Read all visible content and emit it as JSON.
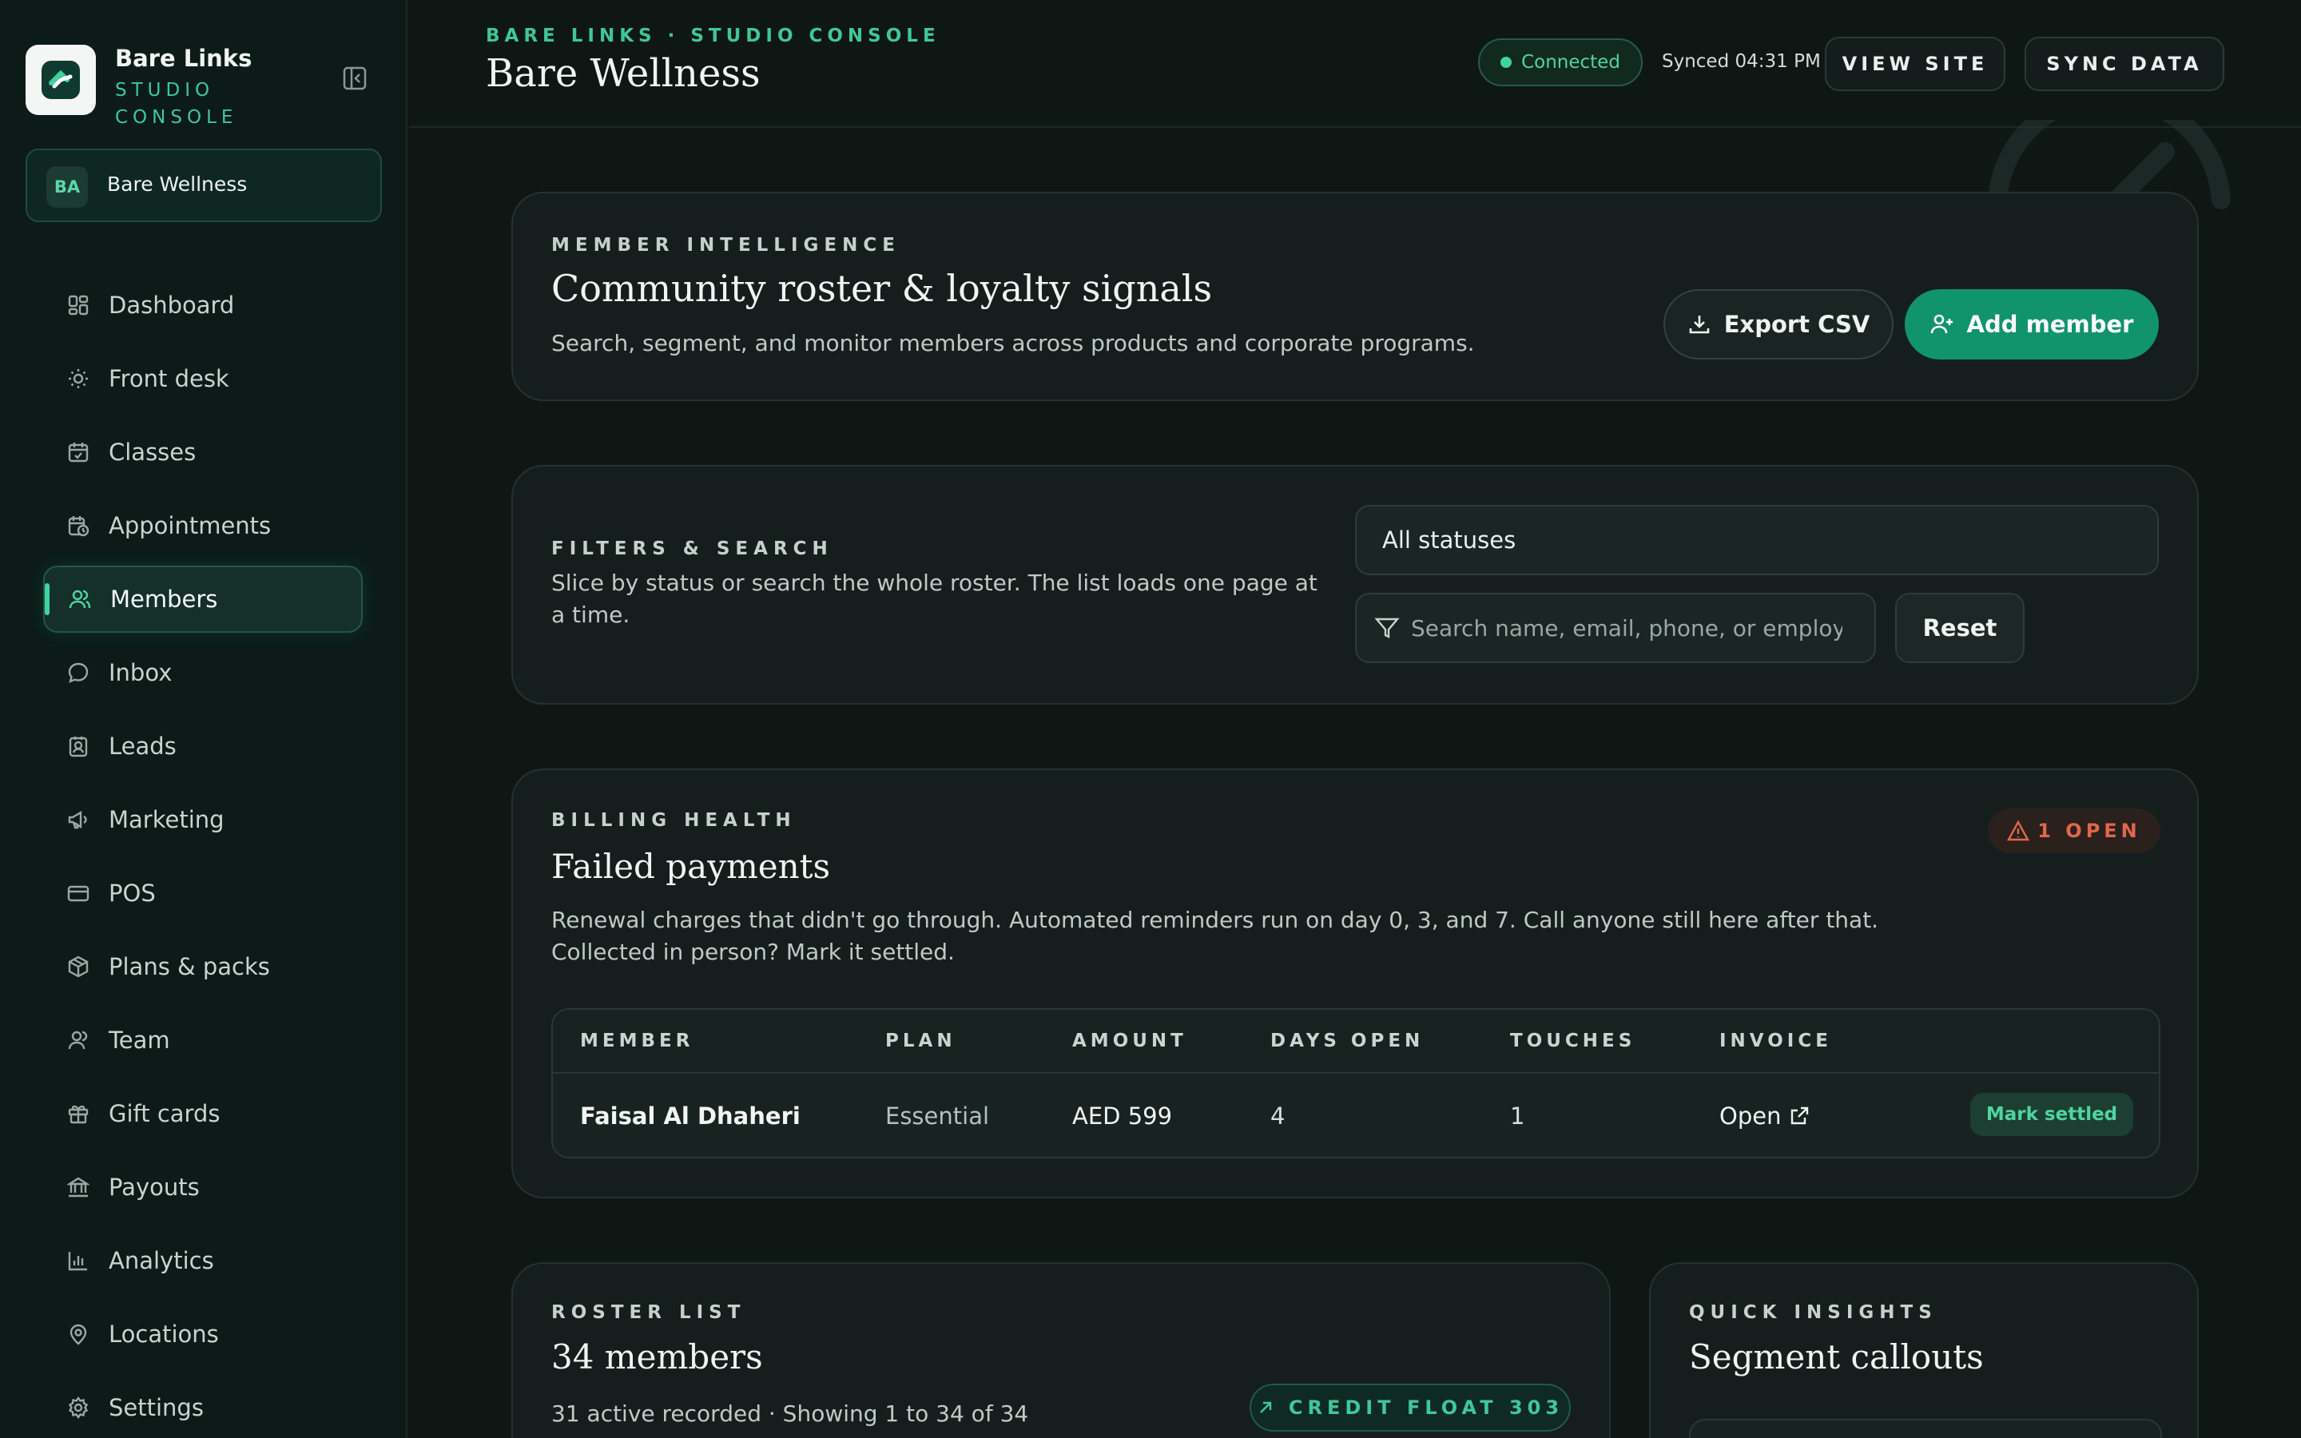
{
  "sidebar": {
    "brand_title": "Bare Links",
    "brand_subtitle": "STUDIO CONSOLE",
    "workspace": {
      "avatar": "BA",
      "name": "Bare Wellness"
    },
    "items": [
      {
        "label": "Dashboard",
        "icon": "dashboard-icon"
      },
      {
        "label": "Front desk",
        "icon": "sun-icon"
      },
      {
        "label": "Classes",
        "icon": "calendar-icon"
      },
      {
        "label": "Appointments",
        "icon": "calendar-clock-icon"
      },
      {
        "label": "Members",
        "icon": "users-icon",
        "active": true
      },
      {
        "label": "Inbox",
        "icon": "chat-icon"
      },
      {
        "label": "Leads",
        "icon": "contact-icon"
      },
      {
        "label": "Marketing",
        "icon": "megaphone-icon"
      },
      {
        "label": "POS",
        "icon": "credit-card-icon"
      },
      {
        "label": "Plans & packs",
        "icon": "package-icon"
      },
      {
        "label": "Team",
        "icon": "team-icon"
      },
      {
        "label": "Gift cards",
        "icon": "gift-icon"
      },
      {
        "label": "Payouts",
        "icon": "bank-icon"
      },
      {
        "label": "Analytics",
        "icon": "bar-chart-icon"
      },
      {
        "label": "Locations",
        "icon": "map-pin-icon"
      },
      {
        "label": "Settings",
        "icon": "gear-icon"
      }
    ]
  },
  "header": {
    "eyebrow": "BARE LINKS · STUDIO CONSOLE",
    "title": "Bare Wellness",
    "status": "Connected",
    "synced": "Synced 04:31 PM",
    "view_site": "VIEW SITE",
    "sync_data": "SYNC DATA"
  },
  "intel": {
    "eyebrow": "MEMBER INTELLIGENCE",
    "title": "Community roster & loyalty signals",
    "desc": "Search, segment, and monitor members across products and corporate programs.",
    "export_label": "Export CSV",
    "add_label": "Add member"
  },
  "filters": {
    "eyebrow": "FILTERS & SEARCH",
    "desc": "Slice by status or search the whole roster. The list loads one page at a time.",
    "status_value": "All statuses",
    "search_placeholder": "Search name, email, phone, or employer",
    "reset_label": "Reset"
  },
  "billing": {
    "eyebrow": "BILLING HEALTH",
    "title": "Failed payments",
    "badge": "1 OPEN",
    "desc": "Renewal charges that didn't go through. Automated reminders run on day 0, 3, and 7. Call anyone still here after that. Collected in person? Mark it settled.",
    "columns": [
      "MEMBER",
      "PLAN",
      "AMOUNT",
      "DAYS OPEN",
      "TOUCHES",
      "INVOICE"
    ],
    "rows": [
      {
        "member": "Faisal Al Dhaheri",
        "plan": "Essential",
        "amount": "AED 599",
        "days_open": "4",
        "touches": "1",
        "invoice": "Open",
        "action": "Mark settled"
      }
    ]
  },
  "roster": {
    "eyebrow": "ROSTER LIST",
    "title": "34 members",
    "summary": "31 active recorded · Showing 1 to 34 of 34",
    "credit": "CREDIT FLOAT 303"
  },
  "insights": {
    "eyebrow": "QUICK INSIGHTS",
    "title": "Segment callouts"
  },
  "colors": {
    "accent": "#3fc79a",
    "primary_button": "#11946a",
    "warning": "#e0674d",
    "background": "#0f1715",
    "sidebar": "#0c1b17"
  }
}
